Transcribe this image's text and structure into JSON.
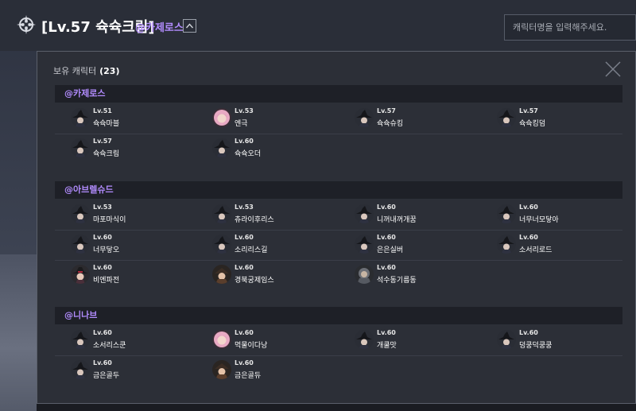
{
  "header": {
    "character_title": "[Lv.57 슉슉크림]",
    "server_tag": "@카제로스",
    "search_placeholder": "캐릭터명을 입력해주세요."
  },
  "panel": {
    "title": "보유 캐릭터",
    "count": "(23)"
  },
  "servers": [
    {
      "name": "@카제로스",
      "characters": [
        {
          "level": "Lv.51",
          "name": "슉슉마블",
          "avatar": "dark-hat-avatar"
        },
        {
          "level": "Lv.53",
          "name": "엔극",
          "avatar": "pink-hair-avatar"
        },
        {
          "level": "Lv.57",
          "name": "슉슉슈킹",
          "avatar": "dark-hat-avatar"
        },
        {
          "level": "Lv.57",
          "name": "슉슉킹덤",
          "avatar": "dark-hat-avatar"
        },
        {
          "level": "Lv.57",
          "name": "슉슉크림",
          "avatar": "dark-hat-avatar"
        },
        {
          "level": "Lv.60",
          "name": "슉슉오더",
          "avatar": "dark-hat-avatar"
        }
      ]
    },
    {
      "name": "@아브렐슈드",
      "characters": [
        {
          "level": "Lv.53",
          "name": "마포마식이",
          "avatar": "dark-hat-avatar"
        },
        {
          "level": "Lv.53",
          "name": "츄라이후리스",
          "avatar": "dark-hat-avatar"
        },
        {
          "level": "Lv.60",
          "name": "니꺼내꺼개꿈",
          "avatar": "dark-hat-avatar"
        },
        {
          "level": "Lv.60",
          "name": "너무너모닿아",
          "avatar": "dark-hat-avatar"
        },
        {
          "level": "Lv.60",
          "name": "너무닿오",
          "avatar": "dark-hat-avatar"
        },
        {
          "level": "Lv.60",
          "name": "소리리스길",
          "avatar": "dark-hat-avatar"
        },
        {
          "level": "Lv.60",
          "name": "은은실버",
          "avatar": "dark-hat-avatar"
        },
        {
          "level": "Lv.60",
          "name": "소서리로드",
          "avatar": "dark-hat-avatar"
        },
        {
          "level": "Lv.60",
          "name": "비엔파전",
          "avatar": "red-hat-avatar"
        },
        {
          "level": "Lv.60",
          "name": "경북궁제임스",
          "avatar": "gunner-avatar"
        },
        {
          "level": "Lv.60",
          "name": "석수동기름동",
          "avatar": "armored-avatar"
        }
      ]
    },
    {
      "name": "@니나브",
      "characters": [
        {
          "level": "Lv.60",
          "name": "소서리스쿤",
          "avatar": "dark-hat-avatar"
        },
        {
          "level": "Lv.60",
          "name": "먹물이다낭",
          "avatar": "pink-hair-avatar"
        },
        {
          "level": "Lv.60",
          "name": "개쿨맛",
          "avatar": "dark-hat-avatar"
        },
        {
          "level": "Lv.60",
          "name": "덩쿵덕쿵쿵",
          "avatar": "dark-hat-avatar"
        },
        {
          "level": "Lv.60",
          "name": "금은골두",
          "avatar": "dark-hat-avatar"
        },
        {
          "level": "Lv.60",
          "name": "금은골듀",
          "avatar": "gunner-avatar"
        }
      ]
    }
  ],
  "colors": {
    "accent": "#b28cff",
    "panel": "#2c2f37",
    "server_header": "#1e2027"
  }
}
